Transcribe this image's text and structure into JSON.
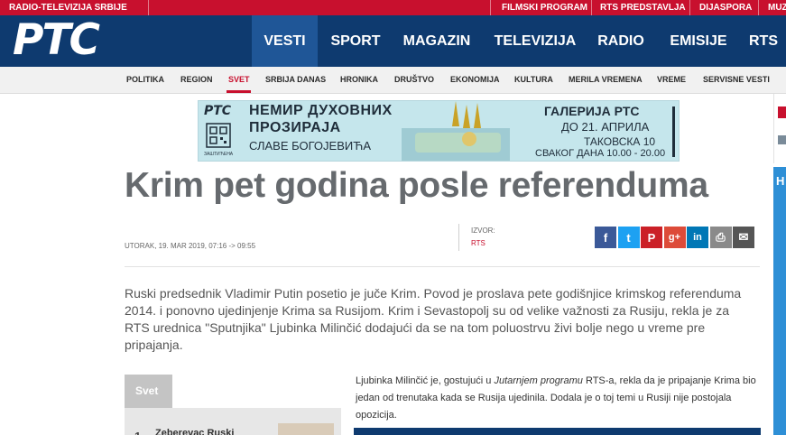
{
  "top_bar": {
    "site_name": "RADIO-TELEVIZIJA SRBIJE",
    "links": [
      "FILMSKI PROGRAM",
      "RTS PREDSTAVLJA",
      "DIJASPORA",
      "MUZ"
    ]
  },
  "header": {
    "logo": "PTC",
    "nav": [
      "VESTI",
      "SPORT",
      "MAGAZIN",
      "TELEVIZIJA",
      "RADIO",
      "EMISIJE",
      "RTS"
    ],
    "active_nav": "VESTI"
  },
  "subnav": {
    "items": [
      "POLITIKA",
      "REGION",
      "SVET",
      "SRBIJA DANAS",
      "HRONIKA",
      "DRUŠTVO",
      "EKONOMIJA",
      "KULTURA",
      "MERILA VREMENA",
      "VREME",
      "SERVISNE VESTI"
    ],
    "active": "SVET"
  },
  "banner": {
    "logo": "PTC",
    "line1": "НЕМИР ДУХОВНИХ",
    "line2": "ПРОЗИРАЈА",
    "line3": "СЛАВЕ БОГОЈЕВИЋА",
    "small": "ЗАШТИЋЕНА",
    "right1": "ГАЛЕРИЈА РТС",
    "right2": "ДО 21. АПРИЛА",
    "right3": "ТАКОВСКА 10",
    "right4": "СВАКОГ ДАНА 10.00 - 20.00"
  },
  "article": {
    "title": "Krim pet godina posle referenduma",
    "date": "UTORAK, 19. MAR 2019, 07:16 -> 09:55",
    "source_label": "IZVOR:",
    "source_value": "RTS",
    "lead": "Ruski predsednik Vladimir Putin posetio je juče Krim. Povod je proslava pete godišnjice krimskog referenduma 2014. i ponovno ujedinjenje Krima sa Rusijom. Krim i Sevastopolj su od velike važnosti za Rusiju, rekla je za RTS urednica \"Sputnjika\" Ljubinka Milinčić dodajući da se na tom poluostrvu živi bolje nego u vreme pre pripajanja.",
    "body_before_em": "Ljubinka Milinčić je, gostujući u ",
    "body_em": "Jutarnjem programu",
    "body_after_em": " RTS-a, rekla da je pripajanje Krima bio jedan od trenutaka kada se Rusija ujedinila. Dodala je o toj temi u Rusiji nije postojala opozicija."
  },
  "share": {
    "icons": [
      "facebook-icon",
      "twitter-icon",
      "pinterest-icon",
      "google-plus-icon",
      "linkedin-icon",
      "print-icon",
      "email-icon"
    ],
    "glyphs": [
      "f",
      "t",
      "P",
      "g+",
      "in",
      "⎙",
      "✉"
    ],
    "colors": [
      "#3b5998",
      "#1da1f2",
      "#cb2027",
      "#dd4b39",
      "#0077b5",
      "#8a8a8a",
      "#555555"
    ]
  },
  "sidebar": {
    "tab_label": "Svet",
    "item_number": "1",
    "item_text": "Zeberevac Ruski"
  },
  "colors": {
    "brand_red": "#c8102e",
    "header_blue": "#0e3a6f",
    "active_nav_blue": "#1f5697"
  }
}
